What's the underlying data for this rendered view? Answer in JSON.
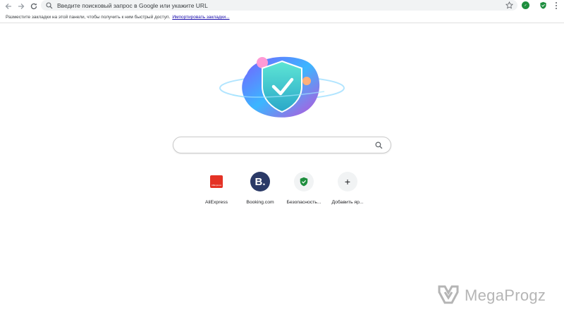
{
  "toolbar": {
    "back_icon": "arrow-left-icon",
    "forward_icon": "arrow-right-icon",
    "reload_icon": "reload-icon",
    "omnibox_placeholder": "Введите поисковый запрос в Google или укажите URL",
    "star_icon": "star-icon",
    "extensions": [
      "green-badge-extension-icon",
      "green-shield-extension-icon"
    ],
    "menu_icon": "kebab-menu-icon"
  },
  "bookmarks_bar": {
    "message": "Разместите закладки на этой панели, чтобы получить к ним быстрый доступ.",
    "import_link": "Импортировать закладки..."
  },
  "hero": {
    "illustration": "shield-checkmark-illustration"
  },
  "search": {
    "value": "",
    "icon": "search-icon"
  },
  "shortcuts": [
    {
      "label": "AliExpress",
      "icon": "aliexpress-icon"
    },
    {
      "label": "Booking.com",
      "icon": "booking-icon",
      "icon_text": "B."
    },
    {
      "label": "Безопасность...",
      "icon": "shield-check-icon"
    },
    {
      "label": "Добавить яр...",
      "icon": "plus-icon"
    }
  ],
  "watermark": {
    "text": "MegaProgz"
  },
  "colors": {
    "omnibox_bg": "#f1f3f4",
    "link": "#1a0dab",
    "aliexpress": "#e43225",
    "booking": "#2b3a67",
    "shield_green": "#1e8e3e"
  }
}
